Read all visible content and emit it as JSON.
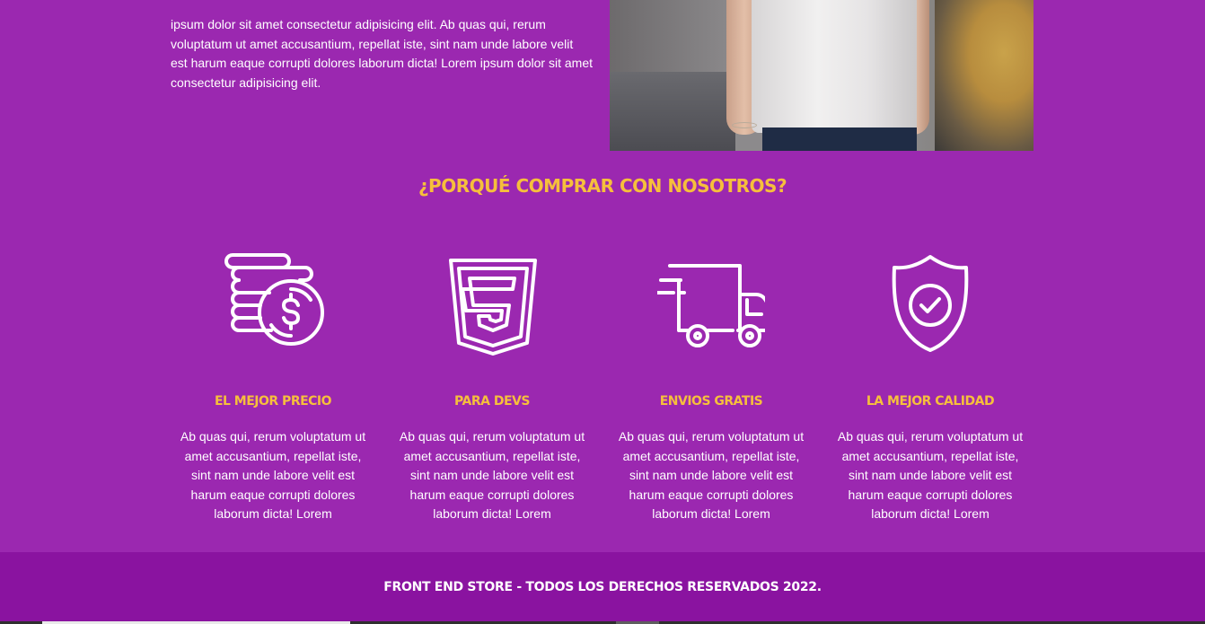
{
  "about": {
    "text": "ipsum dolor sit amet consectetur adipisicing elit. Ab quas qui, rerum voluptatum ut amet accusantium, repellat iste, sint nam unde labore velit est harum eaque corrupti dolores laborum dicta! Lorem ipsum dolor sit amet consectetur adipisicing elit."
  },
  "why": {
    "title": "¿Porqué comprar con nosotros?"
  },
  "features": [
    {
      "icon": "coins-dollar-icon",
      "title": "El mejor precio",
      "text": "Ab quas qui, rerum voluptatum ut amet accusantium, repellat iste, sint nam unde labore velit est harum eaque corrupti dolores laborum dicta! Lorem"
    },
    {
      "icon": "html5-icon",
      "title": "Para devs",
      "text": "Ab quas qui, rerum voluptatum ut amet accusantium, repellat iste, sint nam unde labore velit est harum eaque corrupti dolores laborum dicta! Lorem"
    },
    {
      "icon": "delivery-truck-icon",
      "title": "Envios gratis",
      "text": "Ab quas qui, rerum voluptatum ut amet accusantium, repellat iste, sint nam unde labore velit est harum eaque corrupti dolores laborum dicta! Lorem"
    },
    {
      "icon": "shield-check-icon",
      "title": "La mejor calidad",
      "text": "Ab quas qui, rerum voluptatum ut amet accusantium, repellat iste, sint nam unde labore velit est harum eaque corrupti dolores laborum dicta! Lorem"
    }
  ],
  "footer": {
    "text": "Front End Store - Todos los derechos reservados 2022."
  },
  "colors": {
    "background": "#9b28b0",
    "footer_background": "#8a13a0",
    "accent": "#f6bf3c",
    "text": "#ffffff"
  }
}
